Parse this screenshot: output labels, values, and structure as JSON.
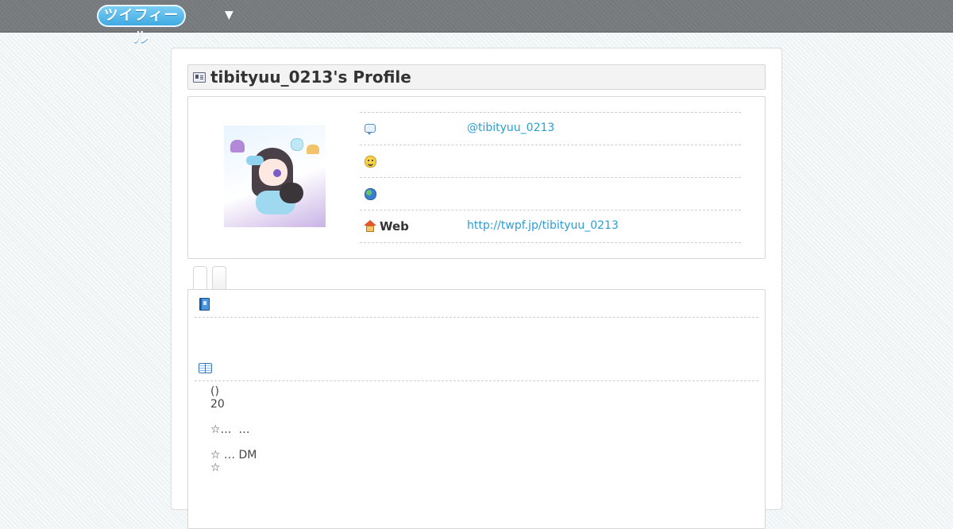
{
  "header": {
    "logo_text": "ツイフィール",
    "menu_toggle_glyph": "▼"
  },
  "profile": {
    "title": "tibityuu_0213's Profile",
    "rows": [
      {
        "icon": "speech-bubble-icon",
        "label": "",
        "value": "@tibityuu_0213"
      },
      {
        "icon": "smiley-icon",
        "label": "",
        "value": ""
      },
      {
        "icon": "globe-icon",
        "label": "",
        "value": ""
      },
      {
        "icon": "house-icon",
        "label": "Web",
        "value": "http://twpf.jp/tibityuu_0213"
      }
    ]
  },
  "tabs": [
    {
      "label": ""
    },
    {
      "label": ""
    }
  ],
  "content": {
    "sections": [
      {
        "icon": "blue-book-icon",
        "title": ""
      },
      {
        "icon": "open-book-icon",
        "title": ""
      }
    ],
    "bio_lines": [
      "()",
      "20",
      "",
      "☆…  …",
      "",
      "☆ … DM",
      "☆"
    ]
  },
  "colors": {
    "link": "#2a9fd6",
    "topbar": "#7b7e81",
    "logo": "#3aa7e0"
  }
}
